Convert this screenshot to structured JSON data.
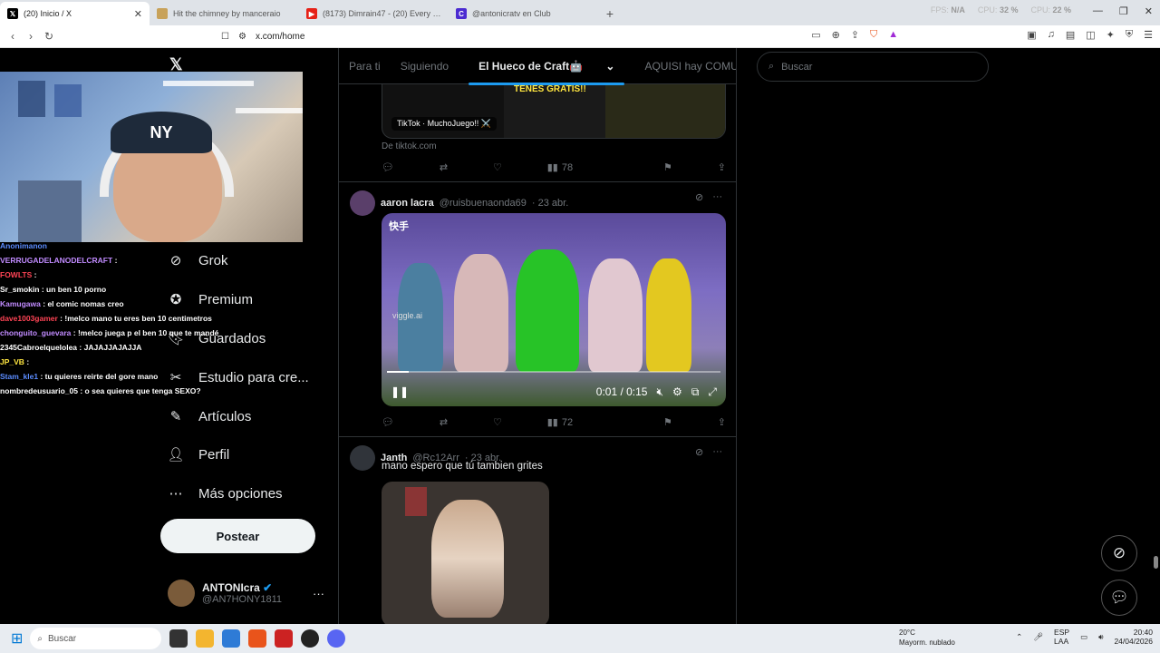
{
  "browser": {
    "tabs": [
      {
        "label": "(20) Inicio / X",
        "icon": "x-logo-icon",
        "color": "#000000",
        "active": true
      },
      {
        "label": "Hit the chimney by manceraio",
        "icon": "page-icon",
        "color": "#c8a25a",
        "active": false
      },
      {
        "label": "(8173) Dimrain47 - (20) Every End...",
        "icon": "youtube-icon",
        "color": "#e62117",
        "active": false
      },
      {
        "label": "@antonicratv en Club",
        "icon": "club-icon",
        "color": "#4b2bd1",
        "active": false
      }
    ],
    "stats": [
      {
        "k": "FPS",
        "v": "N/A"
      },
      {
        "k": "CPU",
        "v": "32 %"
      },
      {
        "k": "CPU",
        "v": "22 %"
      },
      {
        "k": "RAM",
        "v": "N/A"
      }
    ],
    "url": "x.com/home"
  },
  "stream_chat": [
    {
      "user": "Anonimanon",
      "msg": "",
      "color": "#5b8cff"
    },
    {
      "user": "VERRUGADELANODELCRAFT",
      "msg": ": ",
      "color": "#c18bff"
    },
    {
      "user": "FOWLTS",
      "msg": ": ",
      "color": "#ff4455"
    },
    {
      "user": "Sr_smokin",
      "msg": ": un ben 10 porno",
      "color": "#ffffff"
    },
    {
      "user": "Kamugawa",
      "msg": ": el comic nomas creo",
      "color": "#c18bff"
    },
    {
      "user": "dave1003gamer",
      "msg": ": !melco mano tu eres ben 10 centimetros",
      "color": "#ff4455"
    },
    {
      "user": "chonguito_guevara",
      "msg": ": !melco juega p el ben 10 que te mandé",
      "color": "#c18bff"
    },
    {
      "user": "2345Cabroelquelolea",
      "msg": ": JAJAJJAJAJJA",
      "color": "#ffffff"
    },
    {
      "user": "JP_VB",
      "msg": ": ",
      "color": "#ffe640"
    },
    {
      "user": "Stam_kle1",
      "msg": ": tu quieres reirte del gore mano",
      "color": "#5b8cff"
    },
    {
      "user": "nombredeusuario_05",
      "msg": ": o sea quieres que tenga SEXO?",
      "color": "#ffffff"
    }
  ],
  "sidebar": {
    "items": [
      {
        "label": "Grok",
        "icon": "grok-icon"
      },
      {
        "label": "Premium",
        "icon": "premium-icon"
      },
      {
        "label": "Guardados",
        "icon": "bookmark-icon"
      },
      {
        "label": "Estudio para cre...",
        "icon": "studio-icon"
      },
      {
        "label": "Artículos",
        "icon": "articles-icon"
      },
      {
        "label": "Perfil",
        "icon": "profile-icon"
      },
      {
        "label": "Más opciones",
        "icon": "more-options-icon"
      }
    ],
    "post_label": "Postear",
    "account": {
      "name": "ANTONIcra",
      "handle": "@AN7HONY1811"
    }
  },
  "feed_tabs": [
    {
      "label": "Para ti",
      "selected": false
    },
    {
      "label": "Siguiendo",
      "selected": false
    },
    {
      "label": "El Hueco de Craft🤖",
      "selected": true
    },
    {
      "label": "AQUISI hay COMUNIDAD",
      "selected": false
    }
  ],
  "posts": [
    {
      "card_text": "TENES GRATIS!!",
      "card_tag": "TikTok · MuchoJuego!! ⚔️",
      "source": "De tiktok.com",
      "views": "78"
    },
    {
      "name": "aaron lacra",
      "handle": "@ruisbuenaonda69",
      "date": "· 23 abr.",
      "video_logo": "快手",
      "video_watermark": "viggle.ai",
      "time": "0:01 / 0:15",
      "progress": 0.066,
      "views": "72"
    },
    {
      "name": "Janth",
      "handle": "@Rc12Arr",
      "date": "· 23 abr.",
      "text": "mano espero que tú tambien grites"
    }
  ],
  "search": {
    "placeholder": "Buscar"
  },
  "taskbar": {
    "search": "Buscar",
    "weather_temp": "20°C",
    "weather_desc": "Mayorm. nublado",
    "lang1": "ESP",
    "lang2": "LAA",
    "time": "20:40",
    "date": "24/04/2026"
  },
  "colors": {
    "accent": "#1d9bf0",
    "verified": "#1d9bf0"
  }
}
